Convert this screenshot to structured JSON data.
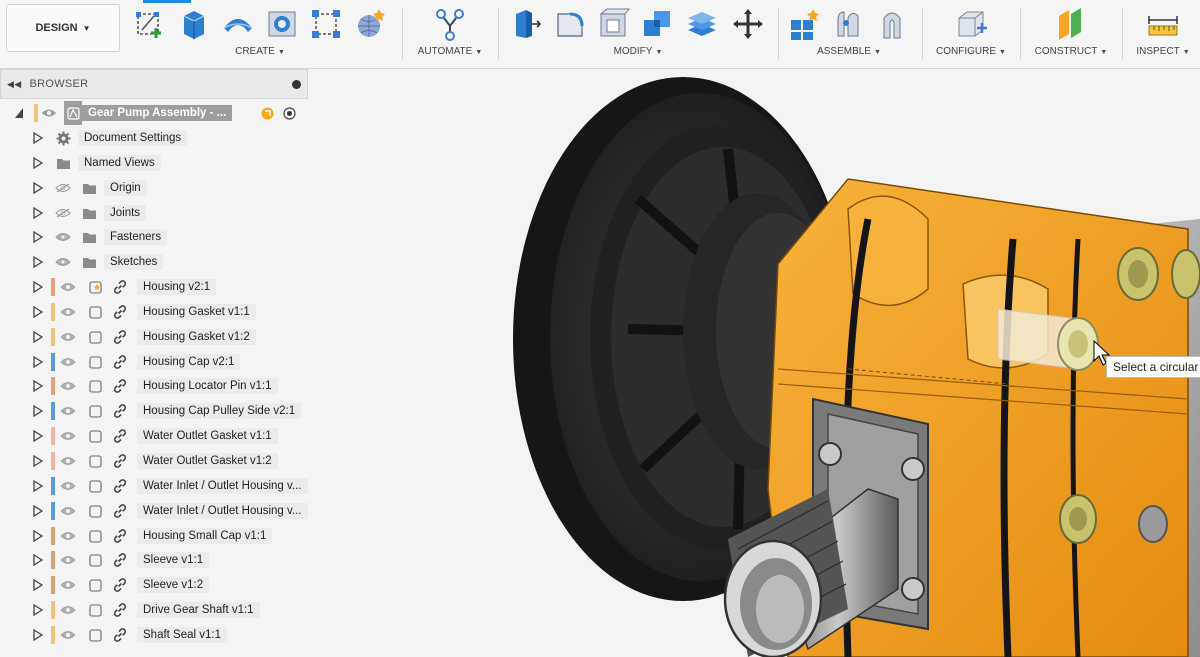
{
  "toolbar": {
    "workspace": "DESIGN",
    "groups": [
      {
        "label": "CREATE"
      },
      {
        "label": "AUTOMATE"
      },
      {
        "label": "MODIFY"
      },
      {
        "label": "ASSEMBLE"
      },
      {
        "label": "CONFIGURE"
      },
      {
        "label": "CONSTRUCT"
      },
      {
        "label": "INSPECT"
      }
    ]
  },
  "browser": {
    "title": "BROWSER",
    "root": {
      "label": "Gear Pump Assembly - ..."
    },
    "folders": [
      {
        "label": "Document Settings"
      },
      {
        "label": "Named Views"
      },
      {
        "label": "Origin"
      },
      {
        "label": "Joints"
      },
      {
        "label": "Fasteners"
      },
      {
        "label": "Sketches"
      }
    ],
    "components": [
      {
        "label": "Housing v2:1",
        "color": "#e8a07a"
      },
      {
        "label": "Housing Gasket v1:1",
        "color": "#f0c27a"
      },
      {
        "label": "Housing Gasket v1:2",
        "color": "#f0c27a"
      },
      {
        "label": "Housing Cap v2:1",
        "color": "#5b9bd5"
      },
      {
        "label": "Housing Locator Pin v1:1",
        "color": "#e8a07a"
      },
      {
        "label": "Housing Cap Pulley Side v2:1",
        "color": "#5b9bd5"
      },
      {
        "label": "Water Outlet Gasket v1:1",
        "color": "#f2b4a0"
      },
      {
        "label": "Water Outlet Gasket v1:2",
        "color": "#f2b4a0"
      },
      {
        "label": "Water Inlet / Outlet Housing v...",
        "color": "#5b9bd5"
      },
      {
        "label": "Water Inlet / Outlet Housing v...",
        "color": "#5b9bd5"
      },
      {
        "label": "Housing Small Cap v1:1",
        "color": "#d4a373"
      },
      {
        "label": "Sleeve v1:1",
        "color": "#d4a373"
      },
      {
        "label": "Sleeve v1:2",
        "color": "#d4a373"
      },
      {
        "label": "Drive Gear Shaft v1:1",
        "color": "#f0c27a"
      },
      {
        "label": "Shaft Seal v1:1",
        "color": "#f0c27a"
      }
    ]
  },
  "viewport": {
    "tooltip": "Select a circular"
  },
  "colors": {
    "accent": "#1e88e5",
    "housing": "#f2a11f",
    "pulley": "#2b2b2b",
    "metal": "#a9a9a9"
  }
}
